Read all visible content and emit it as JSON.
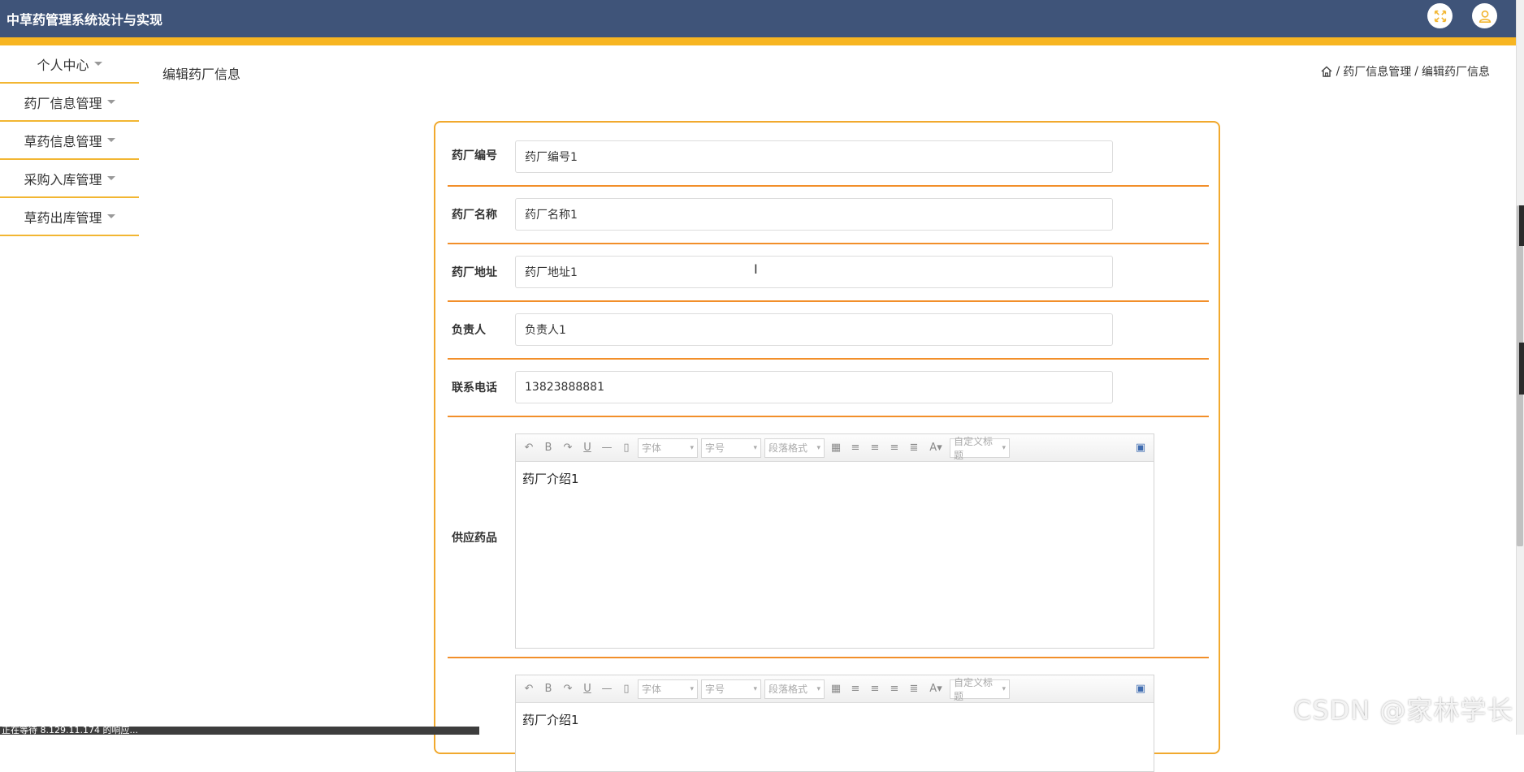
{
  "app": {
    "title": "中草药管理系统设计与实现"
  },
  "sidebar": {
    "items": [
      {
        "label": "个人中心"
      },
      {
        "label": "药厂信息管理"
      },
      {
        "label": "草药信息管理"
      },
      {
        "label": "采购入库管理"
      },
      {
        "label": "草药出库管理"
      }
    ]
  },
  "page": {
    "title": "编辑药厂信息"
  },
  "breadcrumb": {
    "level1": "药厂信息管理",
    "level2": "编辑药厂信息",
    "separator": "/"
  },
  "form": {
    "fields": [
      {
        "label": "药厂编号",
        "value": "药厂编号1"
      },
      {
        "label": "药厂名称",
        "value": "药厂名称1"
      },
      {
        "label": "药厂地址",
        "value": "药厂地址1"
      },
      {
        "label": "负责人",
        "value": "负责人1"
      },
      {
        "label": "联系电话",
        "value": "13823888881"
      }
    ],
    "editor1": {
      "label": "供应药品",
      "content": "药厂介绍1"
    },
    "editor2": {
      "label": "",
      "content": "药厂介绍1"
    }
  },
  "editor_toolbar": {
    "bold": "B",
    "underline": "U",
    "hr": "—",
    "font_family": "字体",
    "font_size": "字号",
    "paragraph": "段落格式",
    "font_color": "A",
    "custom_title": "自定义标题"
  },
  "status": {
    "text": "正在等待 8.129.11.174 的响应..."
  },
  "watermark": {
    "text": "CSDN @家林学长"
  },
  "colors": {
    "topbar": "#3f5479",
    "accent": "#f7b521",
    "border": "#f1a92e"
  }
}
